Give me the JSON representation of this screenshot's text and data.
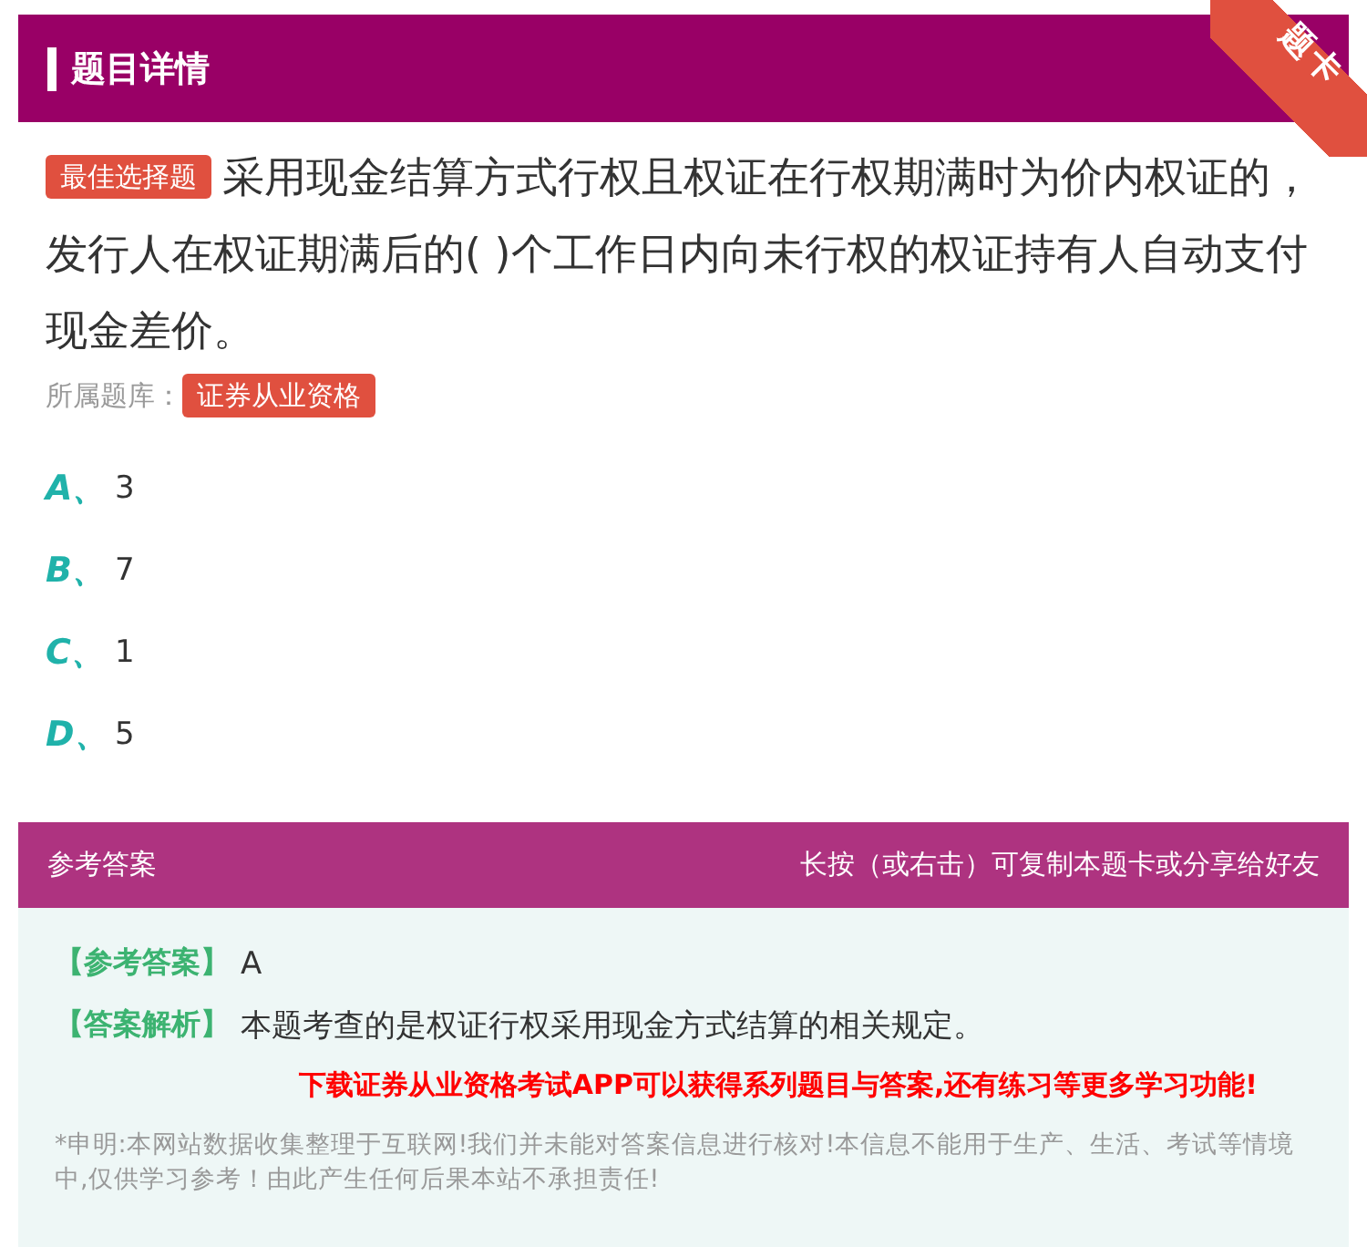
{
  "header": {
    "title": "题目详情",
    "ribbon": "题卡"
  },
  "question": {
    "type_tag": "最佳选择题",
    "text": "采用现金结算方式行权且权证在行权期满时为价内权证的，发行人在权证期满后的( )个工作日内向未行权的权证持有人自动支付现金差价。",
    "bank_label": "所属题库：",
    "bank_tag": "证券从业资格"
  },
  "options": [
    {
      "letter": "A、",
      "text": "3"
    },
    {
      "letter": "B、",
      "text": "7"
    },
    {
      "letter": "C、",
      "text": "1"
    },
    {
      "letter": "D、",
      "text": "5"
    }
  ],
  "answer": {
    "title": "参考答案",
    "hint": "长按（或右击）可复制本题卡或分享给好友",
    "answer_label": "【参考答案】",
    "answer_value": "A",
    "analysis_label": "【答案解析】",
    "analysis_text": "本题考查的是权证行权采用现金方式结算的相关规定。",
    "promo": "下载证券从业资格考试APP可以获得系列题目与答案,还有练习等更多学习功能!",
    "disclaimer": "*申明:本网站数据收集整理于互联网!我们并未能对答案信息进行核对!本信息不能用于生产、生活、考试等情境中,仅供学习参考！由此产生任何后果本站不承担责任!"
  }
}
